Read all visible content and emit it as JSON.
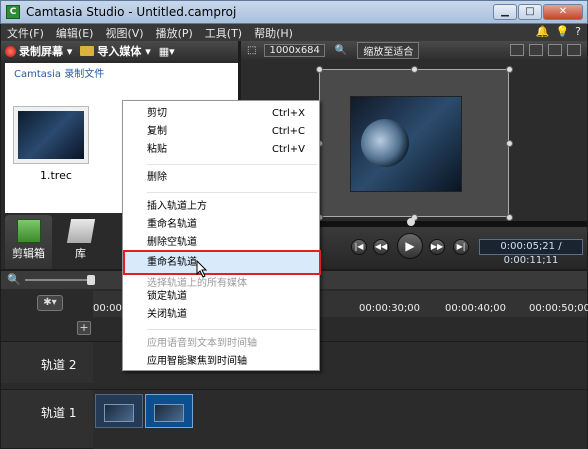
{
  "window": {
    "title": "Camtasia Studio - Untitled.camproj",
    "controls": [
      "▁",
      "□",
      "✕"
    ]
  },
  "menu": [
    "文件(F)",
    "编辑(E)",
    "视图(V)",
    "播放(P)",
    "工具(T)",
    "帮助(H)"
  ],
  "left_toolbar": {
    "record": "录制屏幕",
    "import": "导入媒体"
  },
  "clip_bin": {
    "label": "Camtasia 录制文件",
    "item": "1.trec"
  },
  "tabs": {
    "active": "剪辑箱",
    "library": "库"
  },
  "preview": {
    "dimensions": "1000x684",
    "zoom": "缩放至适合",
    "timecode": "0:00:05;21 / 0:00:11;11"
  },
  "ruler": [
    "00:00:00;00",
    "00:00:30;00",
    "00:00:40;00",
    "00:00:50;00"
  ],
  "tracks": [
    {
      "label": "轨道 2"
    },
    {
      "label": "轨道 1"
    }
  ],
  "context_menu": {
    "items": [
      {
        "label": "剪切",
        "shortcut": "Ctrl+X"
      },
      {
        "label": "复制",
        "shortcut": "Ctrl+C"
      },
      {
        "label": "粘贴",
        "shortcut": "Ctrl+V"
      },
      {
        "label": "删除",
        "shortcut": ""
      },
      {
        "label": "插入轨道上方",
        "shortcut": ""
      },
      {
        "label": "重命名轨道",
        "shortcut": ""
      },
      {
        "label": "删除空轨道",
        "shortcut": ""
      },
      {
        "label": "重命名轨道",
        "shortcut": ""
      },
      {
        "label": "选择轨道上的所有媒体",
        "shortcut": ""
      },
      {
        "label": "锁定轨道",
        "shortcut": ""
      },
      {
        "label": "关闭轨道",
        "shortcut": ""
      },
      {
        "label": "应用语音到文本到时间轴",
        "shortcut": ""
      },
      {
        "label": "应用智能聚焦到时间轴",
        "shortcut": ""
      }
    ]
  },
  "colors": {
    "highlight_border": "#e02020",
    "accent": "#2c5aa0"
  }
}
